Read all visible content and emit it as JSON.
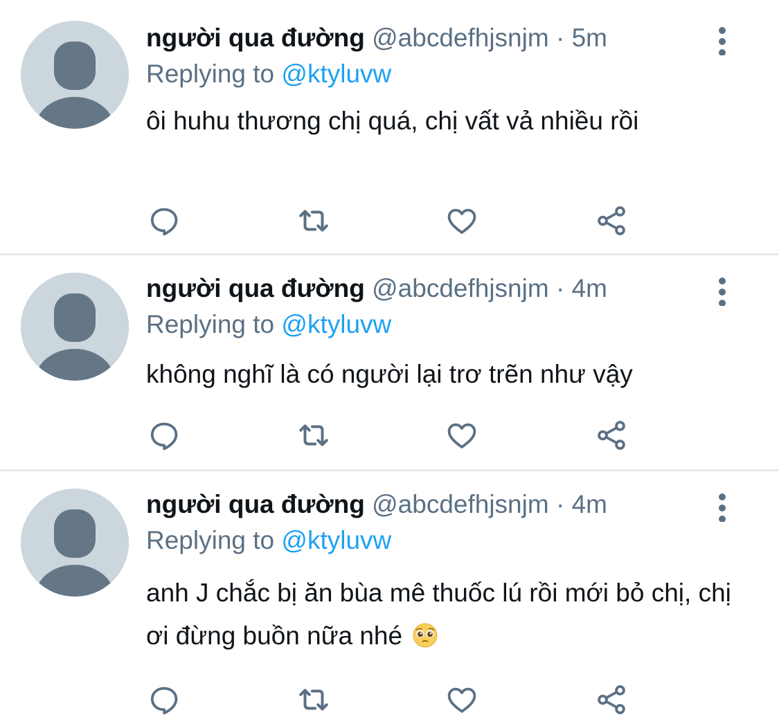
{
  "colors": {
    "text": "#0f1419",
    "secondary": "#5b7083",
    "accent": "#1da1f2",
    "avatar_bg": "#ccd6dd",
    "avatar_fg": "#657786",
    "divider": "#e6ecf0"
  },
  "tweets": [
    {
      "name": "người qua đường",
      "handle": "@abcdefhjsnjm",
      "separator": "·",
      "time": "5m",
      "replying_prefix": "Replying to",
      "replying_to": "@ktyluvw",
      "text": "ôi huhu thương chị quá, chị vất vả nhiều rồi",
      "icons": [
        "reply-icon",
        "retweet-icon",
        "like-icon",
        "share-icon",
        "more-icon"
      ]
    },
    {
      "name": "người qua đường",
      "handle": "@abcdefhjsnjm",
      "separator": "·",
      "time": "4m",
      "replying_prefix": "Replying to",
      "replying_to": "@ktyluvw",
      "text": "không nghĩ là có người lại trơ trẽn như vậy",
      "icons": [
        "reply-icon",
        "retweet-icon",
        "like-icon",
        "share-icon",
        "more-icon"
      ]
    },
    {
      "name": "người qua đường",
      "handle": "@abcdefhjsnjm",
      "separator": "·",
      "time": "4m",
      "replying_prefix": "Replying to",
      "replying_to": "@ktyluvw",
      "text": "anh J chắc bị ăn bùa mê thuốc lú rồi mới bỏ chị, chị ơi đừng buồn nữa nhé",
      "trailing_emoji": "pleading-face-emoji",
      "icons": [
        "reply-icon",
        "retweet-icon",
        "like-icon",
        "share-icon",
        "more-icon"
      ]
    }
  ]
}
